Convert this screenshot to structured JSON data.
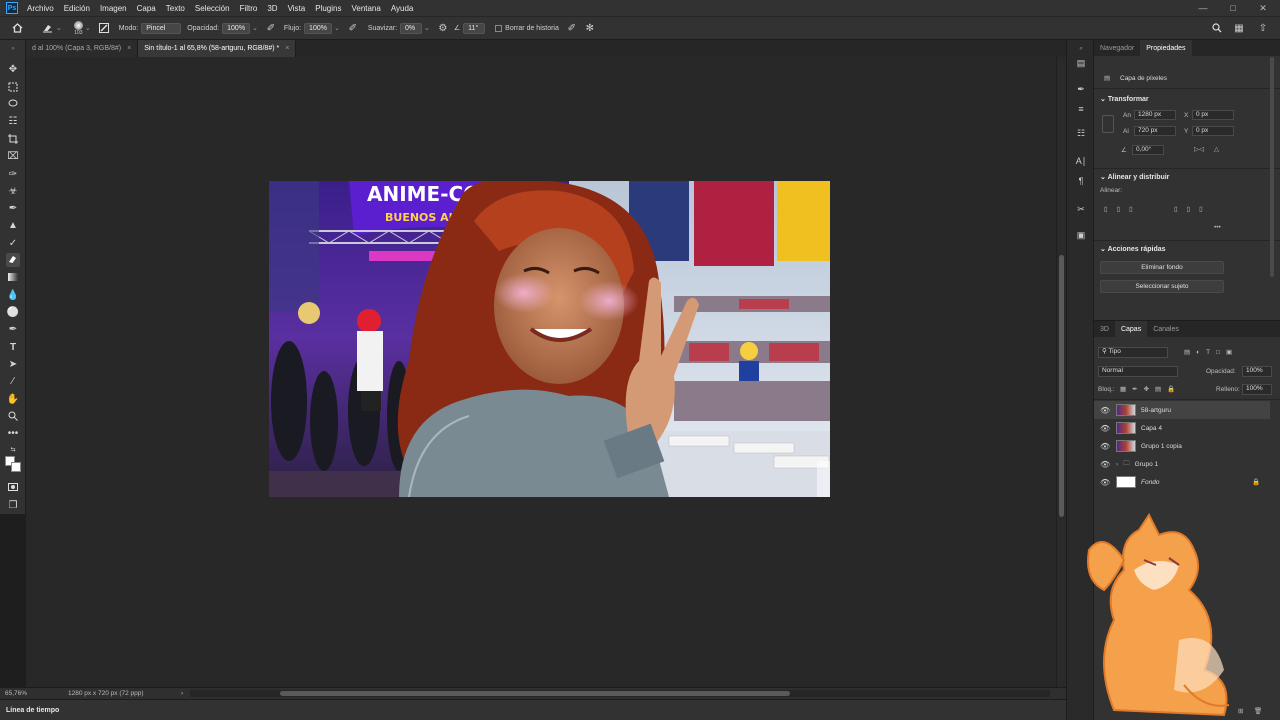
{
  "menubar": {
    "logo": "Ps",
    "items": [
      "Archivo",
      "Edición",
      "Imagen",
      "Capa",
      "Texto",
      "Selección",
      "Filtro",
      "3D",
      "Vista",
      "Plugins",
      "Ventana",
      "Ayuda"
    ]
  },
  "options": {
    "brush_size": "103",
    "mode_label": "Modo:",
    "mode_value": "Pincel",
    "opacity_label": "Opacidad:",
    "opacity_value": "100%",
    "flow_label": "Flujo:",
    "flow_value": "100%",
    "smooth_label": "Suavizar:",
    "smooth_value": "0%",
    "angle_value": "11°",
    "history_label": "Borrar de historia"
  },
  "tabs": [
    {
      "label": "d al 100% (Capa 3, RGB/8#)",
      "close": "×"
    },
    {
      "label": "Sin título-1 al 65,8% (58-artguru, RGB/8#) *",
      "close": "×"
    }
  ],
  "status": {
    "zoom": "65,76%",
    "size": "1280 px x 720 px (72 ppp)",
    "arrow": "›"
  },
  "timeline": {
    "label": "Línea de tiempo"
  },
  "properties": {
    "tabs": [
      "Navegador",
      "Propiedades"
    ],
    "layer_type": "Capa de píxeles",
    "transform": {
      "title": "Transformar",
      "w_label": "An",
      "w_value": "1280 px",
      "h_label": "Al",
      "h_value": "720 px",
      "x_label": "X",
      "x_value": "0 px",
      "y_label": "Y",
      "y_value": "0 px",
      "angle_value": "0,00°"
    },
    "align": {
      "title": "Alinear y distribuir",
      "label": "Alinear:",
      "more": "•••"
    },
    "quick": {
      "title": "Acciones rápidas",
      "btn1": "Eliminar fondo",
      "btn2": "Seleccionar sujeto"
    }
  },
  "layers": {
    "tabs": [
      "3D",
      "Capas",
      "Canales"
    ],
    "filter_value": "Tipo",
    "blend_mode": "Normal",
    "opacity_label": "Opacidad:",
    "opacity_value": "100%",
    "lock_label": "Bloq.:",
    "fill_label": "Relleno:",
    "fill_value": "100%",
    "items": [
      {
        "name": "58-artguru",
        "selected": true
      },
      {
        "name": "Capa 4",
        "selected": false
      },
      {
        "name": "Grupo 1 copia",
        "selected": false
      },
      {
        "name": "Grupo 1",
        "selected": false
      },
      {
        "name": "Fondo",
        "selected": false
      }
    ]
  },
  "document": {
    "banner_line1": "ANIME-CON",
    "banner_line2": "BUENOS AIRE"
  },
  "colors": {
    "accent": "#31a8ff",
    "panel": "#323232",
    "canvas_bg": "#282828"
  }
}
